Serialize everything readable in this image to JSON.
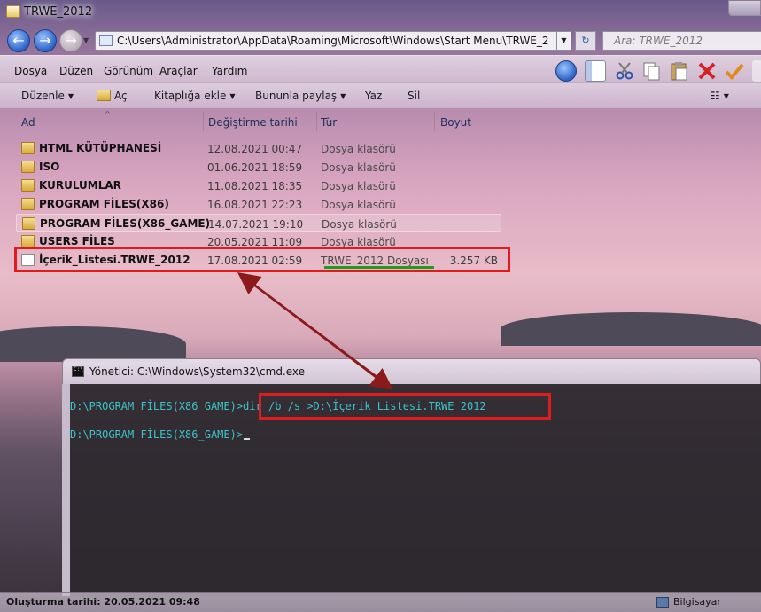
{
  "window": {
    "title": "TRWE_2012"
  },
  "address": {
    "path": "C:\\Users\\Administrator\\AppData\\Roaming\\Microsoft\\Windows\\Start Menu\\TRWE_2",
    "search_placeholder": "Ara: TRWE_2012"
  },
  "menu": [
    "Dosya",
    "Düzen",
    "Görünüm",
    "Araçlar",
    "Yardım"
  ],
  "toolbar_icons": [
    "up-icon",
    "panes-icon",
    "cut-icon",
    "copy-icon",
    "paste-icon",
    "delete-icon",
    "check-icon"
  ],
  "commands": {
    "organize": "Düzenle",
    "open": "Aç",
    "include_library": "Kitaplığa ekle",
    "share": "Bununla paylaş",
    "burn": "Yaz",
    "delete": "Sil"
  },
  "columns": {
    "name": "Ad",
    "date": "Değiştirme tarihi",
    "type": "Tür",
    "size": "Boyut"
  },
  "files": [
    {
      "name": "HTML KÜTÜPHANESİ",
      "date": "12.08.2021 00:47",
      "type": "Dosya klasörü",
      "size": "",
      "icon": "folder-icon"
    },
    {
      "name": "ISO",
      "date": "01.06.2021 18:59",
      "type": "Dosya klasörü",
      "size": "",
      "icon": "folder-icon"
    },
    {
      "name": "KURULUMLAR",
      "date": "11.08.2021 18:35",
      "type": "Dosya klasörü",
      "size": "",
      "icon": "folder-icon"
    },
    {
      "name": "PROGRAM FİLES(X86)",
      "date": "16.08.2021 22:23",
      "type": "Dosya klasörü",
      "size": "",
      "icon": "folder-icon"
    },
    {
      "name": "PROGRAM FİLES(X86_GAME)",
      "date": "14.07.2021 19:10",
      "type": "Dosya klasörü",
      "size": "",
      "icon": "folder-icon"
    },
    {
      "name": "USERS FİLES",
      "date": "20.05.2021 11:09",
      "type": "Dosya klasörü",
      "size": "",
      "icon": "folder-icon"
    },
    {
      "name": "İçerik_Listesi.TRWE_2012",
      "date": "17.08.2021 02:59",
      "type": "TRWE_2012 Dosyası",
      "size": "3.257 KB",
      "icon": "document-icon"
    }
  ],
  "cmd": {
    "title": "Yönetici: C:\\Windows\\System32\\cmd.exe",
    "prompt1": "D:\\PROGRAM FİLES(X86_GAME)>",
    "command": "dir /b /s >D:\\İçerik_Listesi.TRWE_2012",
    "prompt2": "D:\\PROGRAM FİLES(X86_GAME)>"
  },
  "status": {
    "created": "Oluşturma tarihi: 20.05.2021 09:48",
    "location": "Bilgisayar"
  },
  "colors": {
    "highlight": "#e01b1b",
    "underline": "#1f9d1f",
    "arrow": "#8b1a1a",
    "cmd_text": "#3ac4c9"
  }
}
